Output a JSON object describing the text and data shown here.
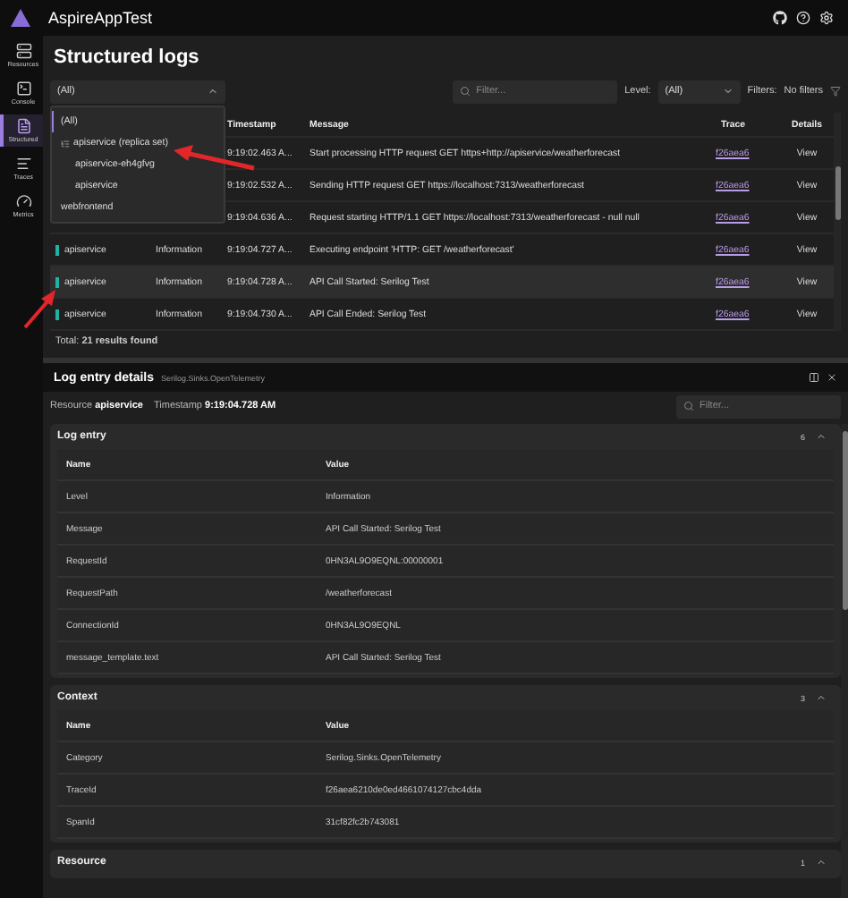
{
  "app": {
    "title": "AspireAppTest"
  },
  "nav": [
    {
      "label": "Resources",
      "selected": false
    },
    {
      "label": "Console",
      "selected": false
    },
    {
      "label": "Structured",
      "selected": true
    },
    {
      "label": "Traces",
      "selected": false
    },
    {
      "label": "Metrics",
      "selected": false
    }
  ],
  "page": {
    "title": "Structured logs"
  },
  "resource_select": {
    "value": "(All)",
    "expanded": true,
    "options": [
      {
        "label": "(All)",
        "selected": true
      },
      {
        "label": "apiservice (replica set)",
        "selected": false,
        "children": [
          {
            "label": "apiservice-eh4gfvg",
            "selected": false
          },
          {
            "label": "apiservice",
            "selected": false
          }
        ]
      },
      {
        "label": "webfrontend",
        "selected": false
      }
    ]
  },
  "search": {
    "placeholder": "Filter..."
  },
  "level": {
    "label": "Level:",
    "value": "(All)"
  },
  "filters": {
    "label": "Filters:",
    "value": "No filters"
  },
  "table": {
    "columns": [
      "Timestamp",
      "Message",
      "Trace",
      "Details"
    ],
    "rows": [
      {
        "timestamp": "9:19:02.463 A...",
        "message": "Start processing HTTP request GET https+http://apiservice/weatherforecast",
        "trace": "f26aea6",
        "details": "View",
        "selected": false
      },
      {
        "timestamp": "9:19:02.532 A...",
        "message": "Sending HTTP request GET https://localhost:7313/weatherforecast",
        "trace": "f26aea6",
        "details": "View",
        "selected": false
      },
      {
        "timestamp": "9:19:04.636 A...",
        "message": "Request starting HTTP/1.1 GET https://localhost:7313/weatherforecast - null null",
        "trace": "f26aea6",
        "details": "View",
        "selected": false
      },
      {
        "resource": "apiservice",
        "level": "Information",
        "timestamp": "9:19:04.727 A...",
        "message": "Executing endpoint 'HTTP: GET /weatherforecast'",
        "trace": "f26aea6",
        "details": "View",
        "selected": false
      },
      {
        "resource": "apiservice",
        "level": "Information",
        "timestamp": "9:19:04.728 A...",
        "message": "API Call Started: Serilog Test",
        "trace": "f26aea6",
        "details": "View",
        "selected": true
      },
      {
        "resource": "apiservice",
        "level": "Information",
        "timestamp": "9:19:04.730 A...",
        "message": "API Call Ended: Serilog Test",
        "trace": "f26aea6",
        "details": "View",
        "selected": false
      }
    ]
  },
  "total": "Total: **21 results found**",
  "details": {
    "title": "Log entry details",
    "subtitle": "Serilog.Sinks.OpenTelemetry",
    "resource_label": "Resource",
    "resource": "apiservice",
    "timestamp_label": "Timestamp",
    "timestamp": "9:19:04.728 AM",
    "filter_placeholder": "Filter...",
    "sections": [
      {
        "title": "Log entry",
        "count": "6",
        "expanded": true,
        "columns": [
          "Name",
          "Value"
        ],
        "rows": [
          [
            "Level",
            "Information"
          ],
          [
            "Message",
            "API Call Started: Serilog Test"
          ],
          [
            "RequestId",
            "0HN3AL9O9EQNL:00000001"
          ],
          [
            "RequestPath",
            "/weatherforecast"
          ],
          [
            "ConnectionId",
            "0HN3AL9O9EQNL"
          ],
          [
            "message_template.text",
            "API Call Started: Serilog Test"
          ]
        ]
      },
      {
        "title": "Context",
        "count": "3",
        "expanded": true,
        "columns": [
          "Name",
          "Value"
        ],
        "rows": [
          [
            "Category",
            "Serilog.Sinks.OpenTelemetry"
          ],
          [
            "TraceId",
            "f26aea6210de0ed4661074127cbc4dda"
          ],
          [
            "SpanId",
            "31cf82fc2b743081"
          ]
        ]
      },
      {
        "title": "Resource",
        "count": "1",
        "expanded": true
      }
    ]
  }
}
